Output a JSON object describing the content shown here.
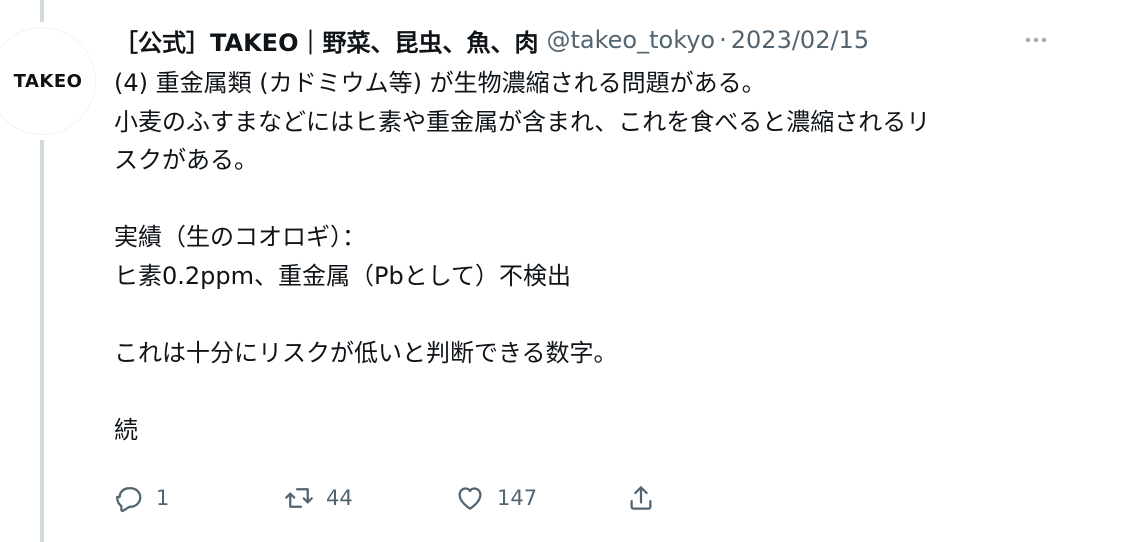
{
  "tweet": {
    "avatar_text": "TAKEO",
    "display_name": "［公式］TAKEO｜野菜、昆虫、魚、肉",
    "handle": "@takeo_tokyo",
    "separator": "·",
    "date": "2023/02/15",
    "more_label": "···",
    "body_lines": [
      "(4) 重金属類 (カドミウム等) が生物濃縮される問題がある。",
      "小麦のふすまなどにはヒ素や重金属が含まれ、これを食べると濃縮されるリ",
      "スクがある。",
      "",
      "実績（生のコオロギ）：",
      "ヒ素0.2ppm、重金属（Pbとして）不検出",
      "",
      "これは十分にリスクが低いと判断できる数字。",
      "",
      "続"
    ],
    "actions": {
      "reply_count": "1",
      "retweet_count": "44",
      "like_count": "147"
    },
    "icons": {
      "reply": "reply-icon",
      "retweet": "retweet-icon",
      "like": "heart-icon",
      "share": "share-icon",
      "more": "more-icon"
    },
    "colors": {
      "text": "#0f1419",
      "secondary": "#536471",
      "thread_line": "#cfd9de"
    }
  }
}
